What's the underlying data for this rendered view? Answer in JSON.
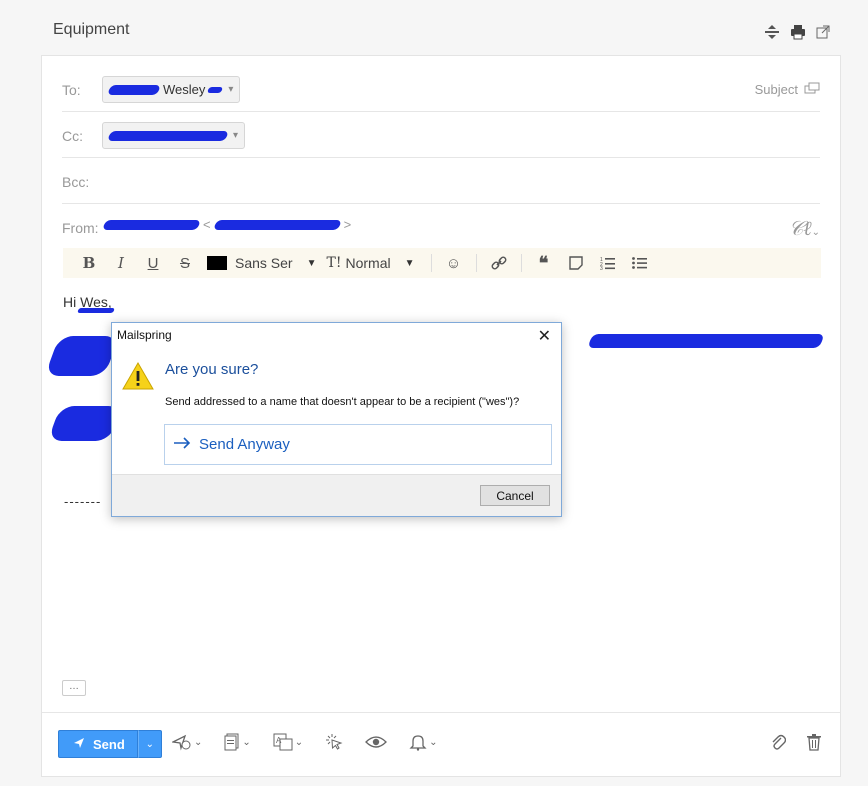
{
  "window": {
    "title": "Equipment"
  },
  "header_icons": [
    "expand-icon",
    "print-icon",
    "popout-icon"
  ],
  "composer": {
    "to_label": "To:",
    "to_token": "Wesley",
    "cc_label": "Cc:",
    "bcc_label": "Bcc:",
    "from_label": "From:",
    "subject_link": "Subject",
    "toolbar": {
      "bold": "B",
      "italic": "I",
      "underline": "U",
      "strike": "S",
      "font": "Sans Ser",
      "size": "Normal",
      "size_prefix": "T!"
    },
    "body_greeting": "Hi Wes,",
    "signature_separator": "-------",
    "more_button": "…"
  },
  "footer": {
    "send_label": "Send"
  },
  "dialog": {
    "title": "Mailspring",
    "close": "✕",
    "heading": "Are you sure?",
    "message": "Send addressed to a name that doesn't appear to be a recipient (\"wes\")?",
    "action": "Send Anyway",
    "cancel": "Cancel"
  },
  "colors": {
    "accent": "#419bf9",
    "dialog_link": "#1b5fbf",
    "toolbar_bg": "#fbf8ee",
    "redaction": "#1a2be0"
  }
}
